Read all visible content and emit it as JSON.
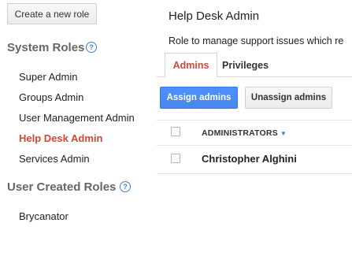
{
  "sidebar": {
    "create_role_label": "Create a new role",
    "system_roles_title": "System Roles",
    "system_roles": [
      {
        "label": "Super Admin"
      },
      {
        "label": "Groups Admin"
      },
      {
        "label": "User Management Admin"
      },
      {
        "label": "Help Desk Admin",
        "active": true
      },
      {
        "label": "Services Admin"
      }
    ],
    "user_roles_title": "User Created Roles",
    "user_roles": [
      {
        "label": "Brycanator"
      }
    ],
    "help_glyph": "?"
  },
  "main": {
    "title": "Help Desk Admin",
    "description": "Role to manage support issues which re",
    "tabs": [
      {
        "label": "Admins",
        "active": true
      },
      {
        "label": "Privileges",
        "active": false
      }
    ],
    "assign_label": "Assign admins",
    "unassign_label": "Unassign admins",
    "table": {
      "column_header": "ADMINISTRATORS",
      "sort_glyph": "▼",
      "rows": [
        {
          "name": "Christopher Alghini"
        }
      ]
    }
  },
  "colors": {
    "accent": "#d14836",
    "primary_button": "#4285f4",
    "help_icon": "#3b7dd8"
  },
  "icons": {
    "help": "help-icon",
    "sort": "sort-down-icon",
    "checkbox": "checkbox-icon"
  }
}
